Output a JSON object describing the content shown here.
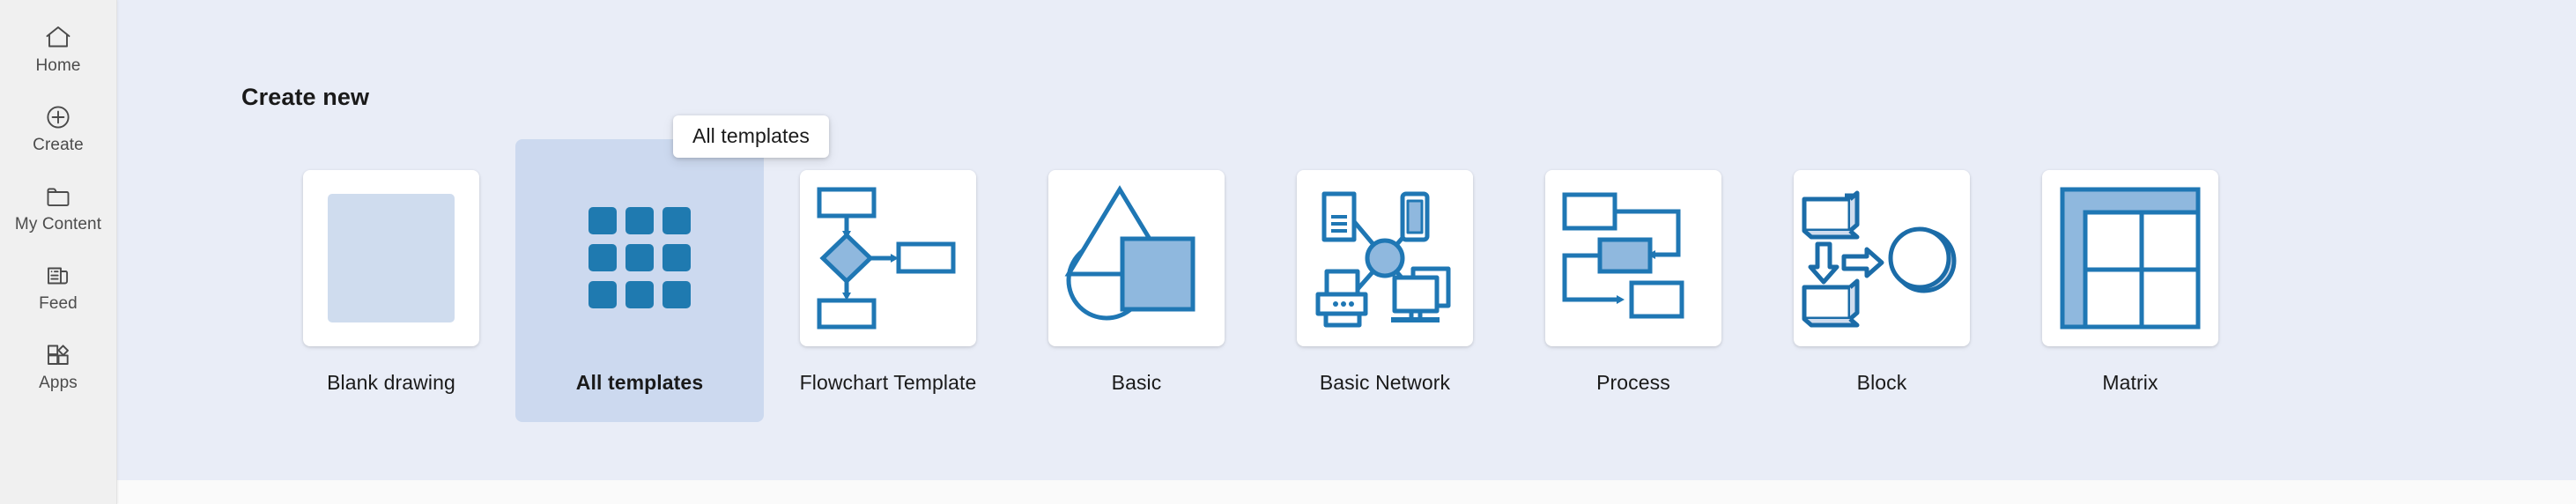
{
  "sidebar": {
    "items": [
      {
        "label": "Home",
        "icon": "home-icon"
      },
      {
        "label": "Create",
        "icon": "plus-circle-icon"
      },
      {
        "label": "My Content",
        "icon": "folder-icon"
      },
      {
        "label": "Feed",
        "icon": "feed-icon"
      },
      {
        "label": "Apps",
        "icon": "apps-icon"
      }
    ]
  },
  "main": {
    "section_title": "Create new",
    "cards": [
      {
        "label": "Blank drawing",
        "icon": "blank-drawing-icon",
        "selected": false
      },
      {
        "label": "All templates",
        "icon": "all-templates-grid-icon",
        "selected": true
      },
      {
        "label": "Flowchart Template",
        "icon": "flowchart-icon",
        "selected": false
      },
      {
        "label": "Basic",
        "icon": "basic-shapes-icon",
        "selected": false
      },
      {
        "label": "Basic Network",
        "icon": "basic-network-icon",
        "selected": false
      },
      {
        "label": "Process",
        "icon": "process-icon",
        "selected": false
      },
      {
        "label": "Block",
        "icon": "block-icon",
        "selected": false
      },
      {
        "label": "Matrix",
        "icon": "matrix-icon",
        "selected": false
      }
    ]
  },
  "tooltip": {
    "text": "All templates"
  },
  "colors": {
    "canvas_background": "#e9edf7",
    "rail_background": "#f0f0f0",
    "page_background": "#fafafa",
    "selected_card_background": "#ccd9ef",
    "accent_blue": "#1f77b4",
    "accent_blue_dark": "#1b6ca8",
    "shape_fill_light": "#cfdcee",
    "shape_fill_medium": "#8fb8de"
  }
}
